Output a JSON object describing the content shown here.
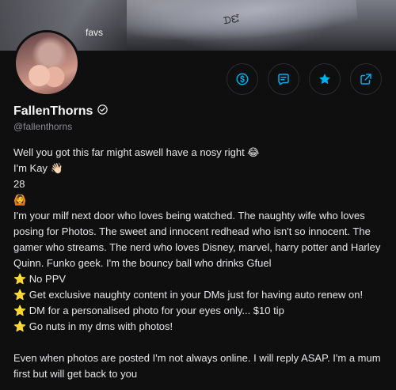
{
  "cover": {
    "caption": "favs",
    "tattoo_text": "ᗪᘿ"
  },
  "profile": {
    "name": "FallenThorns",
    "handle": "@fallenthorns"
  },
  "colors": {
    "accent": "#00aff0",
    "background": "#0f0f10"
  },
  "actions": [
    {
      "icon": "dollar-icon"
    },
    {
      "icon": "message-icon"
    },
    {
      "icon": "star-icon"
    },
    {
      "icon": "share-icon"
    }
  ],
  "bio": {
    "line1": "Well you got this far might aswell have a nosy right 😂",
    "line2": "I'm Kay 👋🏻",
    "line3": "28",
    "line4": "🙆",
    "paragraph": "I'm your milf next door who loves being watched. The naughty wife who loves posing for Photos. The sweet and innocent redhead who isn't so innocent. The gamer who streams. The nerd who loves Disney, marvel, harry potter and Harley Quinn. Funko geek. I'm the bouncy ball who drinks Gfuel",
    "bullets": [
      "⭐ No PPV",
      "⭐ Get exclusive naughty content in your DMs just for having auto renew on!",
      "⭐ DM for a personalised photo for your eyes only... $10 tip",
      "⭐ Go nuts in my dms with photos!"
    ],
    "closing": "Even when photos are posted I'm not always online. I will reply ASAP. I'm a mum first but will get back to you"
  }
}
